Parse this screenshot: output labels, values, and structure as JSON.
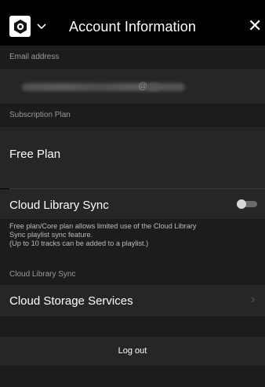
{
  "header": {
    "title": "Account Information",
    "app_icon": "app-logo-icon",
    "dropdown_icon": "chevron-down-icon",
    "close_label": "✕"
  },
  "email": {
    "label": "Email address",
    "at_sign": "@"
  },
  "subscription": {
    "label": "Subscription Plan",
    "value": "Free Plan"
  },
  "cloud_sync": {
    "label": "Cloud Library Sync",
    "toggle_on": false,
    "info_line1": "Free plan/Core plan allows limited use of the Cloud Library",
    "info_line2": "Sync playlist sync feature.",
    "info_line3": "(Up to 10 tracks can be added to a playlist.)",
    "section_label": "Cloud Library Sync"
  },
  "storage": {
    "label": "Cloud Storage Services",
    "chevron": "›"
  },
  "logout": {
    "label": "Log out"
  },
  "colors": {
    "background": "#000000",
    "row": "#262626",
    "section": "#1c1c1c",
    "muted_text": "#9a9a9a"
  }
}
